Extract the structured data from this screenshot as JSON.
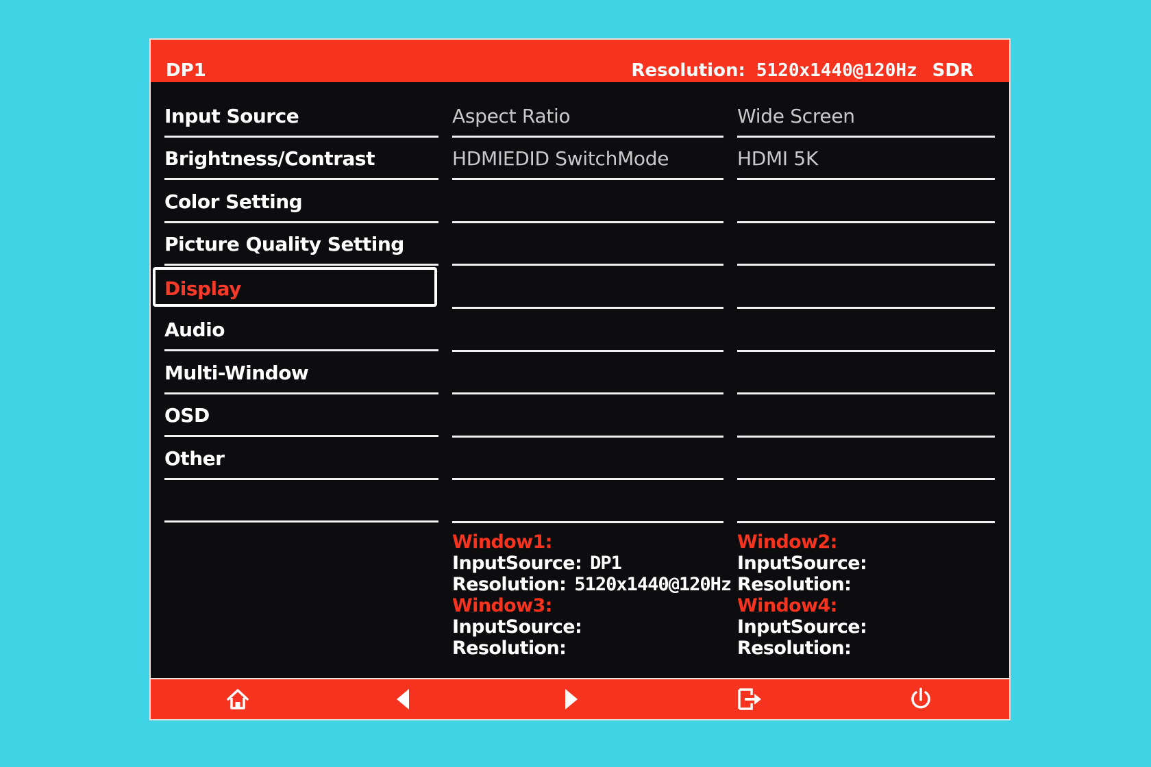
{
  "header": {
    "input": "DP1",
    "resolution_label": "Resolution:",
    "resolution_value": "5120x1440@120Hz",
    "dynamic_range": "SDR"
  },
  "menu": {
    "items": [
      {
        "label": "Input Source"
      },
      {
        "label": "Brightness/Contrast"
      },
      {
        "label": "Color Setting"
      },
      {
        "label": "Picture Quality Setting"
      },
      {
        "label": "Display",
        "selected": true
      },
      {
        "label": "Audio"
      },
      {
        "label": "Multi-Window"
      },
      {
        "label": "OSD"
      },
      {
        "label": "Other"
      },
      {
        "label": ""
      }
    ]
  },
  "submenu": {
    "items": [
      {
        "label": "Aspect Ratio",
        "value": "Wide Screen"
      },
      {
        "label": "HDMIEDID SwitchMode",
        "value": "HDMI 5K"
      }
    ]
  },
  "windows": {
    "w1": {
      "title": "Window1:",
      "input_label": "InputSource:",
      "input_value": "DP1",
      "res_label": "Resolution:",
      "res_value": "5120x1440@120Hz"
    },
    "w2": {
      "title": "Window2:",
      "input_label": "InputSource:",
      "input_value": "",
      "res_label": "Resolution:",
      "res_value": ""
    },
    "w3": {
      "title": "Window3:",
      "input_label": "InputSource:",
      "input_value": "",
      "res_label": "Resolution:",
      "res_value": ""
    },
    "w4": {
      "title": "Window4:",
      "input_label": "InputSource:",
      "input_value": "",
      "res_label": "Resolution:",
      "res_value": ""
    }
  },
  "controls": {
    "icons": [
      "home-icon",
      "left-arrow-icon",
      "right-arrow-icon",
      "exit-icon",
      "power-icon"
    ]
  },
  "colors": {
    "accent": "#f5331e",
    "panel": "#0d0d10",
    "desktop": "#3fd3e6"
  }
}
